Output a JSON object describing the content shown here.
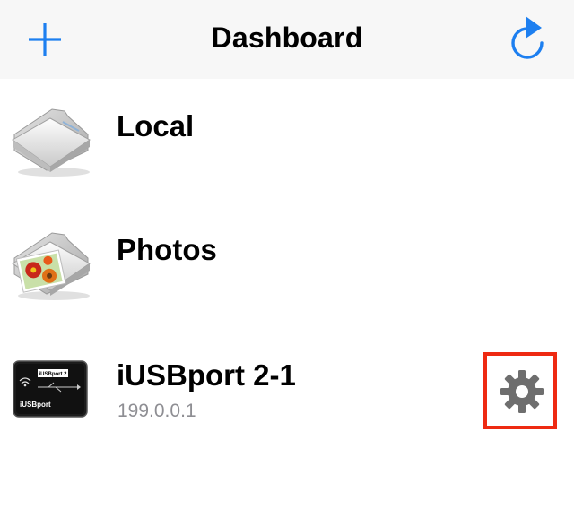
{
  "navbar": {
    "title": "Dashboard",
    "add_icon": "plus-icon",
    "refresh_icon": "refresh-icon",
    "accent_color": "#1d7ff0"
  },
  "items": [
    {
      "label": "Local",
      "icon": "folder-icon"
    },
    {
      "label": "Photos",
      "icon": "photos-folder-icon"
    },
    {
      "label": "iUSBport 2-1",
      "subtitle": "199.0.0.1",
      "icon": "iusbport-device-icon",
      "settings_icon": "gear-icon"
    }
  ],
  "device_icon": {
    "badge_text": "iUSBport 2",
    "brand_text": "iUSBport"
  },
  "highlight_color": "#ee2a12"
}
